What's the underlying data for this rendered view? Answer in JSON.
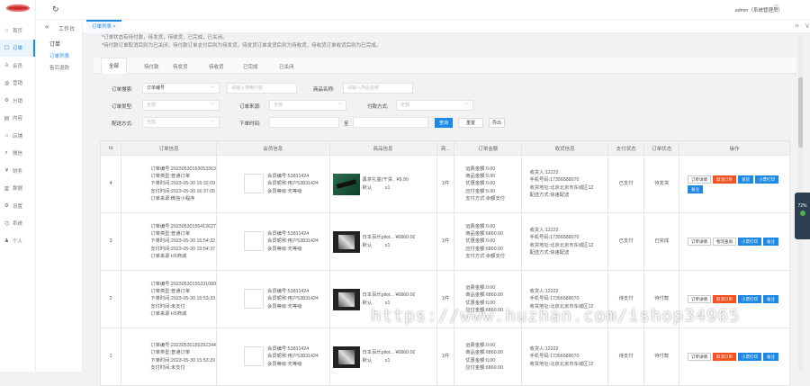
{
  "sidebar": {
    "items": [
      {
        "icon": "⌂",
        "label": "首页"
      },
      {
        "icon": "☐",
        "label": "订单",
        "active": true
      },
      {
        "icon": "♙",
        "label": "会员"
      },
      {
        "icon": "◍",
        "label": "营销"
      },
      {
        "icon": "⚙",
        "label": "分销"
      },
      {
        "icon": "▤",
        "label": "内容"
      },
      {
        "icon": "⌂",
        "label": "店铺"
      },
      {
        "icon": "◐",
        "label": "微信"
      },
      {
        "icon": "¥",
        "label": "财务"
      },
      {
        "icon": "▥",
        "label": "数据"
      },
      {
        "icon": "⚙",
        "label": "设置"
      },
      {
        "icon": "⌬",
        "label": "系统"
      },
      {
        "icon": "♟",
        "label": "个人"
      }
    ]
  },
  "topbar": {
    "refresh": "↻",
    "title": "工作台",
    "user": "admin（系统管理员）",
    "icon1": "⎚",
    "icon2": "⤢"
  },
  "submenu": {
    "collapse": "«",
    "header": "订单",
    "items": [
      "订单列表",
      "售后退款"
    ]
  },
  "tabbar": {
    "tab": "订单列表 ×",
    "more": "»",
    "more2": "∨"
  },
  "notice": [
    "*订单状态有待付款，待发货，待收货，已完成，已关闭。",
    "*待付款订单取消后则为已关闭，待付款订单支付后则为待发货，待发货订单发货后则为待收货，待收货订单收货后则为已完成。"
  ],
  "status_tabs": [
    "全部",
    "待付款",
    "待发货",
    "待收货",
    "已完成",
    "已关闭"
  ],
  "filters": {
    "order_search_label": "订单搜索:",
    "order_search_type": "订单编号",
    "order_search_ph": "请输入搜索内容",
    "goods_name_label": "商品名称:",
    "goods_name_ph": "请输入商品名称",
    "order_type_label": "订单类型:",
    "order_type_val": "全部",
    "order_source_label": "订单来源:",
    "order_source_val": "全部",
    "pay_way_label": "付款方式:",
    "pay_way_val": "全部",
    "delivery_label": "配送方式:",
    "delivery_val": "全部",
    "time_label": "下单时间:",
    "time_sep": "至",
    "search_btn": "查询",
    "reset_btn": "重置",
    "export_btn": "导出"
  },
  "table": {
    "headers": [
      "Id",
      "订单信息",
      "会员信息",
      "商品信息",
      "商...",
      "订单金额",
      "收货信息",
      "支付状态",
      "订单状态",
      "操作"
    ],
    "rows": [
      {
        "id": "4",
        "order": [
          "订单编号:20230530163053363",
          "订单类型:普通订单",
          "下单时间:2023-05-30 16:32:09",
          "支付时间:2023-05-30 16:37:05",
          "订单来源:微信小程序"
        ],
        "member": [
          "会员编号:53831424",
          "会员昵称:用户53831424",
          "会员等级:无等级"
        ],
        "goods_title": "黑茶礼盒(干货..",
        "goods_price": "¥9.90",
        "goods_spec": "默认",
        "goods_num": "x1",
        "amount": [
          "运费金额:0.00",
          "商品金额:9.90",
          "优惠金额:0.00",
          "应付金额:9.90",
          "支付方式:余额支付"
        ],
        "qty": "1件",
        "recv": [
          "收货人:12222",
          "手机号码:17356588070",
          "收货地址:北京北京市东城区12",
          "配送方式:快递配送"
        ],
        "pay": "已支付",
        "status": "待发货",
        "ops": [
          [
            "订单详情",
            ""
          ],
          [
            "取消订单",
            "red"
          ],
          [
            "发货",
            "blue"
          ],
          [
            "小票打印",
            "blue"
          ],
          [
            "备注",
            "blue"
          ]
        ]
      },
      {
        "id": "3",
        "order": [
          "订单编号:20230530155412627",
          "订单类型:普通订单",
          "下单时间:2023-05-30 15:54:32",
          "支付时间:2023-05-30 15:54:37",
          "订单来源:H5商城"
        ],
        "member": [
          "会员编号:53831424",
          "会员昵称:用户53831424",
          "会员等级:无等级"
        ],
        "goods_title": "日本百乐pilot...",
        "goods_price": "¥6860.00",
        "goods_spec": "默认",
        "goods_num": "x1",
        "amount": [
          "运费金额:0.00",
          "商品金额:6860.00",
          "优惠金额:0.00",
          "应付金额:6860.00",
          "支付方式:余额支付"
        ],
        "qty": "1件",
        "recv": [
          "收货人:12222",
          "手机号码:17356588070",
          "收货地址:北京北京市东城区12",
          "配送方式:快递配送"
        ],
        "pay": "已支付",
        "status": "已完成",
        "ops": [
          [
            "订单详情",
            ""
          ],
          [
            "物流查询",
            ""
          ],
          [
            "小票打印",
            "blue"
          ],
          [
            "备注",
            "blue"
          ]
        ]
      },
      {
        "id": "2",
        "order": [
          "订单编号:20230530155331089",
          "订单类型:普通订单",
          "下单时间:2023-05-30 15:53:33",
          "支付时间:未支付",
          "订单来源:H5商城"
        ],
        "member": [
          "会员编号:53831424",
          "会员昵称:用户53831424",
          "会员等级:无等级"
        ],
        "goods_title": "日本百乐pilot...",
        "goods_price": "¥6860.00",
        "goods_spec": "默认",
        "goods_num": "x1",
        "amount": [
          "运费金额:0.00",
          "商品金额:6860.00",
          "优惠金额:0.00",
          "应付金额:6860.00"
        ],
        "qty": "1件",
        "recv": [
          "收货人:12222",
          "手机号码:17356588070",
          "收货地址:北京北京市东城区12"
        ],
        "pay": "待支付",
        "status": "待付款",
        "ops": [
          [
            "订单详情",
            ""
          ],
          [
            "取消订单",
            "red"
          ],
          [
            "小票打印",
            "blue"
          ],
          [
            "备注",
            "blue"
          ]
        ]
      },
      {
        "id": "1",
        "order": [
          "订单编号:20230530155292344",
          "订单类型:普通订单",
          "下单时间:2023-05-30 15:53:29",
          "支付时间:未支付"
        ],
        "member": [
          "会员编号:53831424",
          "会员昵称:用户53831424",
          "会员等级:无等级"
        ],
        "goods_title": "日本百乐pilot...",
        "goods_price": "¥6860.00",
        "goods_spec": "默认",
        "goods_num": "x1",
        "amount": [
          "运费金额:0.00",
          "商品金额:6860.00",
          "优惠金额:0.00",
          "应付金额:6860.00"
        ],
        "qty": "1件",
        "recv": [
          "收货人:12222",
          "手机号码:17356588070",
          "收货地址:北京北京市东城区12"
        ],
        "pay": "待支付",
        "status": "待付款",
        "ops": [
          [
            "订单详情",
            ""
          ],
          [
            "取消订单",
            "red"
          ],
          [
            "小票打印",
            "blue"
          ],
          [
            "备注",
            "blue"
          ]
        ]
      }
    ]
  },
  "widget": {
    "pct": "72",
    "unit": "%"
  },
  "watermark": "https://www.huzhan.com/ishop34965"
}
